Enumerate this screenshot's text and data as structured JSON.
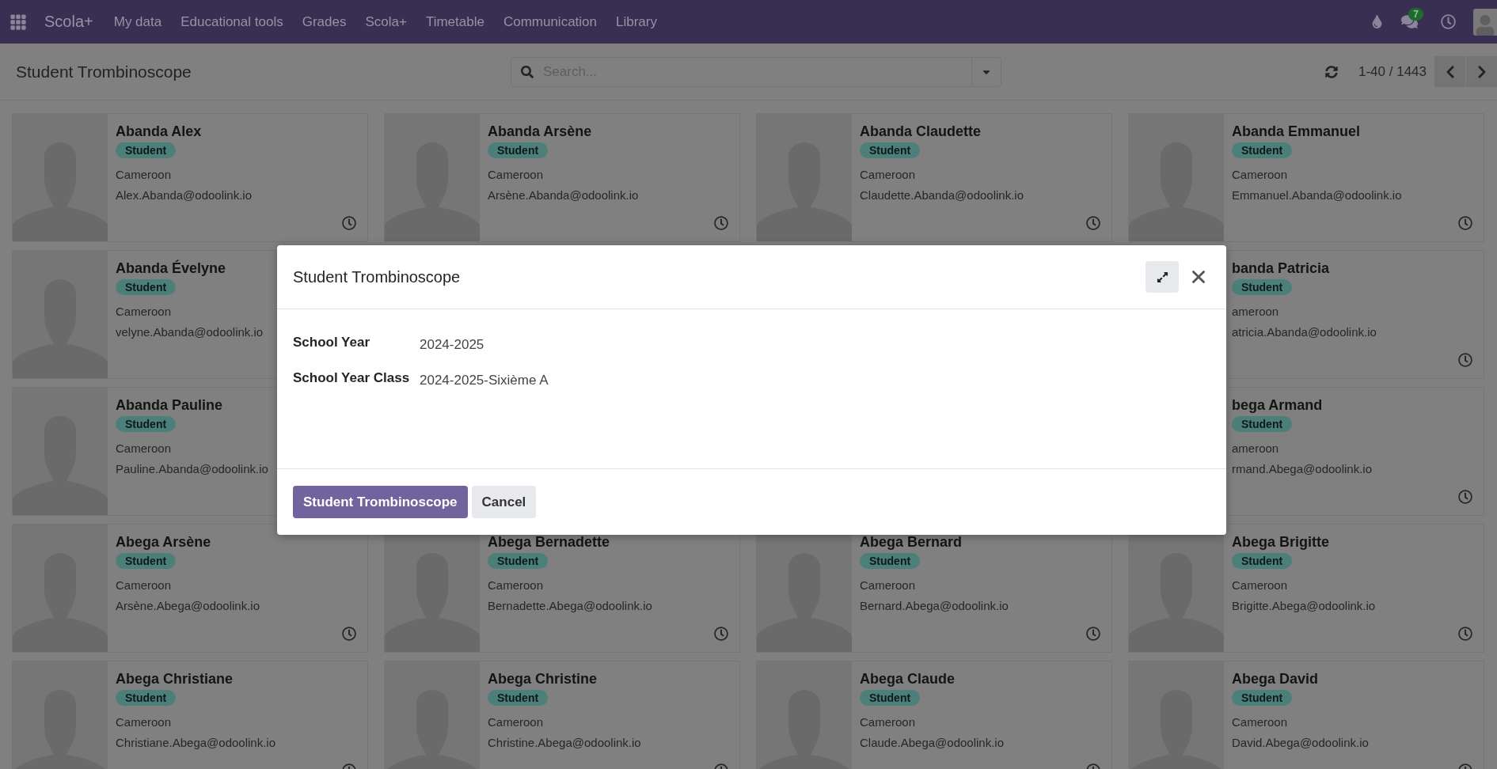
{
  "navbar": {
    "brand": "Scola+",
    "menu": [
      "My data",
      "Educational tools",
      "Grades",
      "Scola+",
      "Timetable",
      "Communication",
      "Library"
    ],
    "messages_badge": "7"
  },
  "control_panel": {
    "title": "Student Trombinoscope",
    "search": {
      "placeholder": "Search..."
    },
    "pager": "1-40 / 1443"
  },
  "card_rows": [
    [
      {
        "name": "Abanda Alex",
        "tag": "Student",
        "country": "Cameroon",
        "email": "Alex.Abanda@odoolink.io"
      },
      {
        "name": "Abanda Arsène",
        "tag": "Student",
        "country": "Cameroon",
        "email": "Arsène.Abanda@odoolink.io"
      },
      {
        "name": "Abanda Claudette",
        "tag": "Student",
        "country": "Cameroon",
        "email": "Claudette.Abanda@odoolink.io"
      },
      {
        "name": "Abanda Emmanuel",
        "tag": "Student",
        "country": "Cameroon",
        "email": "Emmanuel.Abanda@odoolink.io"
      }
    ],
    [
      {
        "name": "Abanda Évelyne",
        "tag": "Student",
        "country": "Cameroon",
        "email": "velyne.Abanda@odoolink.io"
      },
      null,
      null,
      {
        "name": "banda Patricia",
        "tag": "Student",
        "country": "ameroon",
        "email": "atricia.Abanda@odoolink.io"
      }
    ],
    [
      {
        "name": "Abanda Pauline",
        "tag": "Student",
        "country": "Cameroon",
        "email": "Pauline.Abanda@odoolink.io"
      },
      null,
      null,
      {
        "name": "bega Armand",
        "tag": "Student",
        "country": "ameroon",
        "email": "rmand.Abega@odoolink.io"
      }
    ],
    [
      {
        "name": "Abega Arsène",
        "tag": "Student",
        "country": "Cameroon",
        "email": "Arsène.Abega@odoolink.io"
      },
      {
        "name": "Abega Bernadette",
        "tag": "Student",
        "country": "Cameroon",
        "email": "Bernadette.Abega@odoolink.io"
      },
      {
        "name": "Abega Bernard",
        "tag": "Student",
        "country": "Cameroon",
        "email": "Bernard.Abega@odoolink.io"
      },
      {
        "name": "Abega Brigitte",
        "tag": "Student",
        "country": "Cameroon",
        "email": "Brigitte.Abega@odoolink.io"
      }
    ],
    [
      {
        "name": "Abega Christiane",
        "tag": "Student",
        "country": "Cameroon",
        "email": "Christiane.Abega@odoolink.io"
      },
      {
        "name": "Abega Christine",
        "tag": "Student",
        "country": "Cameroon",
        "email": "Christine.Abega@odoolink.io"
      },
      {
        "name": "Abega Claude",
        "tag": "Student",
        "country": "Cameroon",
        "email": "Claude.Abega@odoolink.io"
      },
      {
        "name": "Abega David",
        "tag": "Student",
        "country": "Cameroon",
        "email": "David.Abega@odoolink.io"
      }
    ]
  ],
  "dialog": {
    "title": "Student Trombinoscope",
    "fields": [
      {
        "label": "School Year",
        "value": "2024-2025"
      },
      {
        "label": "School Year Class",
        "value": "2024-2025-Sixième A"
      }
    ],
    "buttons": [
      {
        "label": "Student Trombinoscope",
        "kind": "primary"
      },
      {
        "label": "Cancel",
        "kind": "secondary"
      }
    ]
  }
}
